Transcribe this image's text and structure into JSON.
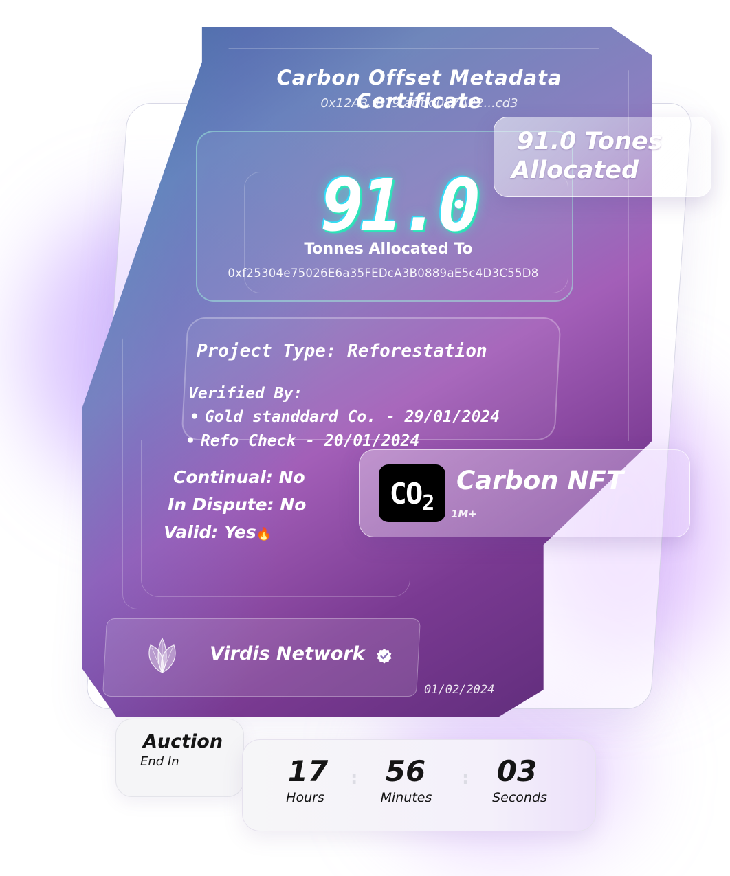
{
  "certificate": {
    "title": "Carbon Offset Metadata Certificate",
    "subtitle": "0x12A3..B79 at tx 0x7A22...cd3",
    "amount": "91.0",
    "amount_label": "Tonnes Allocated To",
    "address": "0xf25304e75026E6a35FEDcA3B0889aE5c4D3C55D8",
    "project_type": "Project Type: Reforestation",
    "verified_by_label": "Verified By:",
    "verifiers": [
      "Gold standdard Co. - 29/01/2024",
      "Refo Check - 20/01/2024"
    ],
    "continual": "Continual: No",
    "in_dispute": "In Dispute: No",
    "valid": "Valid: Yes",
    "valid_icon": "fire-icon",
    "network_name": "Virdis Network",
    "network_icon": "leaf-icon",
    "date": "01/02/2024"
  },
  "tones_badge": {
    "line1": "91.0 Tones",
    "line2": "Allocated"
  },
  "nft_badge": {
    "logo_main": "CO",
    "logo_sub": "2",
    "title": "Carbon NFT",
    "count": "1M+"
  },
  "auction": {
    "title": "Auction",
    "subtitle": "End In",
    "separator": ":",
    "timer": [
      {
        "value": "17",
        "unit": "Hours"
      },
      {
        "value": "56",
        "unit": "Minutes"
      },
      {
        "value": "03",
        "unit": "Seconds"
      }
    ]
  },
  "colors": {
    "card_start": "#4a5c9b",
    "card_end": "#5a2a76",
    "accent_glow": "#3ef5c8",
    "text_dark": "#151515"
  }
}
